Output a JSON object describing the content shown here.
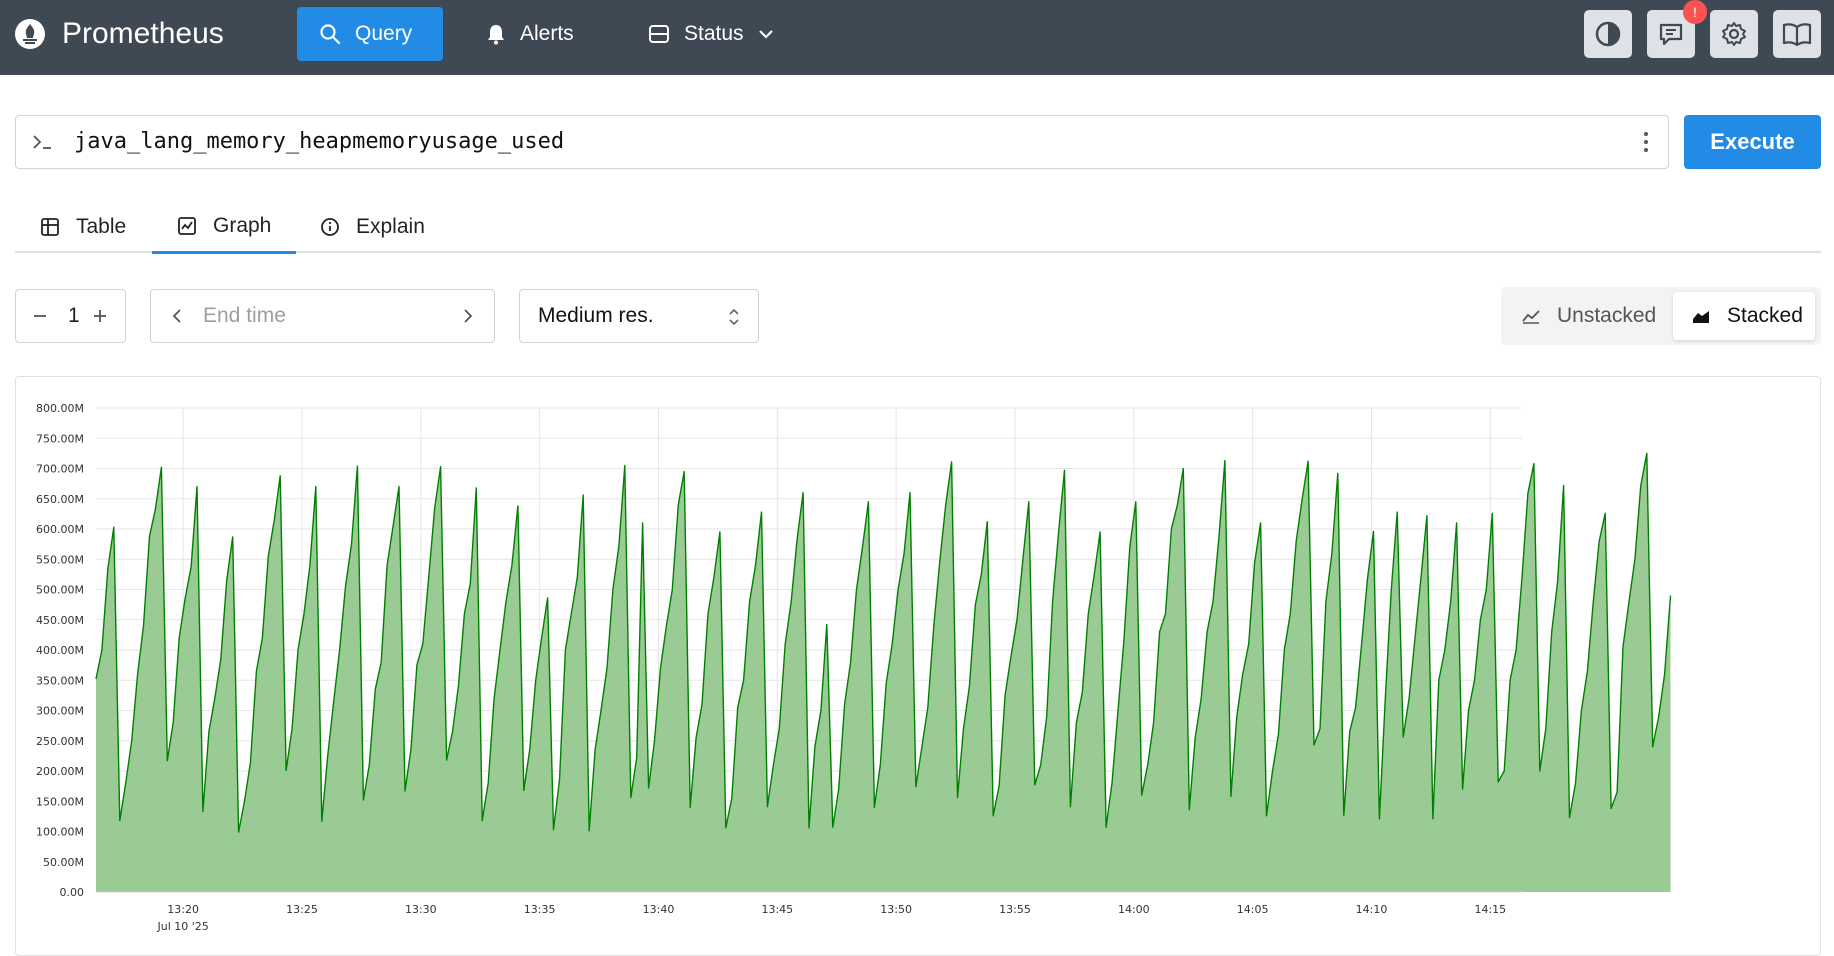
{
  "header": {
    "brand": "Prometheus",
    "nav": {
      "query": "Query",
      "alerts": "Alerts",
      "status": "Status"
    },
    "notification_badge": "!",
    "icons": [
      "theme-toggle-icon",
      "feedback-icon",
      "settings-icon",
      "docs-icon"
    ]
  },
  "query": {
    "expression": "java_lang_memory_heapmemoryusage_used",
    "execute_label": "Execute"
  },
  "tabs": [
    {
      "label": "Table",
      "active": false
    },
    {
      "label": "Graph",
      "active": true
    },
    {
      "label": "Explain",
      "active": false
    }
  ],
  "controls": {
    "range_value": "1",
    "end_time_placeholder": "End time",
    "resolution": "Medium res.",
    "unstacked_label": "Unstacked",
    "stacked_label": "Stacked",
    "selected_mode": "Stacked"
  },
  "colors": {
    "header_bg": "#3f4954",
    "accent": "#228be6",
    "series_line": "#008000",
    "series_fill": "#9bcb95",
    "badge": "#fa5252"
  },
  "chart_data": {
    "type": "area",
    "stacked": true,
    "grid": true,
    "ylim": [
      0,
      800
    ],
    "y_unit": "M",
    "y_tick_labels": [
      "0.00",
      "50.00M",
      "100.00M",
      "150.00M",
      "200.00M",
      "250.00M",
      "300.00M",
      "350.00M",
      "400.00M",
      "450.00M",
      "500.00M",
      "550.00M",
      "600.00M",
      "650.00M",
      "700.00M",
      "750.00M",
      "800.00M"
    ],
    "x_tick_labels": [
      "13:20",
      "13:25",
      "13:30",
      "13:35",
      "13:40",
      "13:45",
      "13:50",
      "13:55",
      "14:00",
      "14:05",
      "14:10",
      "14:15"
    ],
    "x_date_label": "Jul 10 '25",
    "x_start": "13:16:20",
    "x_end": "14:16:20",
    "x_step_seconds": 15,
    "y_values": [
      352,
      400,
      535,
      603,
      118,
      180,
      250,
      360,
      440,
      588,
      633,
      702,
      217,
      280,
      420,
      485,
      537,
      670,
      133,
      265,
      320,
      385,
      515,
      587,
      99,
      150,
      215,
      365,
      420,
      555,
      615,
      688,
      201,
      270,
      400,
      460,
      540,
      670,
      117,
      225,
      315,
      400,
      505,
      575,
      704,
      152,
      210,
      335,
      380,
      540,
      605,
      670,
      167,
      235,
      375,
      410,
      520,
      635,
      703,
      218,
      265,
      340,
      460,
      510,
      668,
      118,
      180,
      320,
      400,
      480,
      540,
      638,
      168,
      235,
      350,
      420,
      486,
      103,
      185,
      400,
      460,
      520,
      656,
      101,
      235,
      300,
      370,
      500,
      572,
      705,
      156,
      222,
      610,
      172,
      250,
      370,
      440,
      500,
      640,
      695,
      140,
      255,
      310,
      460,
      520,
      595,
      106,
      155,
      305,
      350,
      480,
      540,
      628,
      141,
      210,
      270,
      410,
      480,
      583,
      660,
      106,
      240,
      300,
      442,
      107,
      170,
      310,
      380,
      500,
      570,
      645,
      140,
      210,
      345,
      410,
      500,
      560,
      660,
      174,
      240,
      305,
      440,
      545,
      640,
      711,
      156,
      270,
      340,
      475,
      525,
      612,
      126,
      175,
      325,
      390,
      450,
      550,
      645,
      177,
      210,
      290,
      480,
      595,
      697,
      141,
      280,
      330,
      460,
      524,
      595,
      107,
      180,
      300,
      415,
      570,
      645,
      160,
      210,
      280,
      430,
      460,
      600,
      640,
      700,
      136,
      255,
      320,
      430,
      480,
      588,
      713,
      158,
      290,
      360,
      410,
      544,
      610,
      126,
      200,
      260,
      400,
      460,
      580,
      650,
      712,
      243,
      270,
      480,
      560,
      692,
      127,
      265,
      305,
      410,
      518,
      596,
      121,
      320,
      500,
      628,
      256,
      320,
      420,
      520,
      622,
      121,
      350,
      400,
      480,
      610,
      170,
      300,
      350,
      450,
      500,
      626,
      182,
      200,
      350,
      400,
      520,
      659,
      708,
      200,
      270,
      430,
      513,
      672,
      123,
      180,
      300,
      365,
      480,
      580,
      626,
      138,
      165,
      405,
      480,
      550,
      672,
      725,
      240,
      290,
      360,
      490
    ]
  }
}
